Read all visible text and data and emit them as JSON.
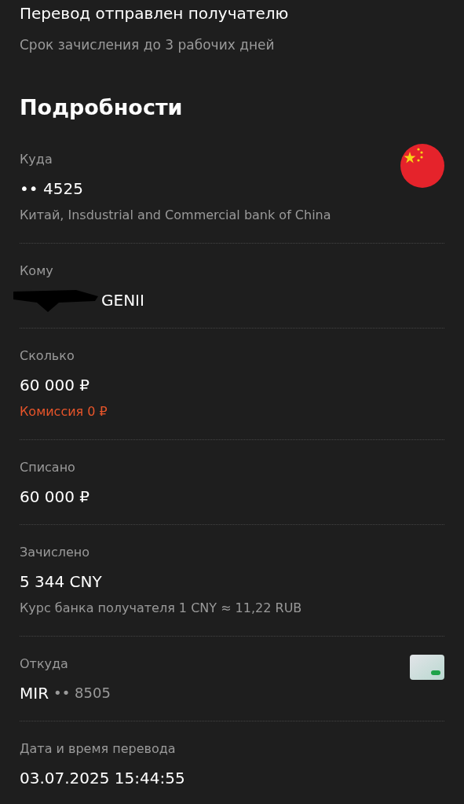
{
  "status": {
    "title": "Перевод отправлен получателю",
    "subtitle": "Срок зачисления до 3 рабочих дней"
  },
  "details": {
    "heading": "Подробности",
    "sections": [
      {
        "label": "Куда",
        "value": "•• 4525",
        "note": {
          "text": "Китай, Insdustrial and Commercial bank of China",
          "kind": "info"
        },
        "kind": "bank"
      },
      {
        "label": "Кому",
        "value": "GENII",
        "redacted": true
      },
      {
        "label": "Сколько",
        "value": "60 000 ₽",
        "note": {
          "text": "Комиссия 0 ₽",
          "kind": "warning"
        }
      },
      {
        "label": "Списано",
        "value": "60 000 ₽"
      },
      {
        "label": "Зачислено",
        "value": "5 344 CNY",
        "note": {
          "text": "Курс банка получателя 1 CNY ≈ 11,22 RUB",
          "kind": "info"
        }
      },
      {
        "label": "Откуда",
        "value": "MIR",
        "value_secondary": "•• 8505",
        "kind": "card"
      },
      {
        "label": "Дата и время перевода",
        "value": "03.07.2025 15:44:55"
      }
    ]
  }
}
